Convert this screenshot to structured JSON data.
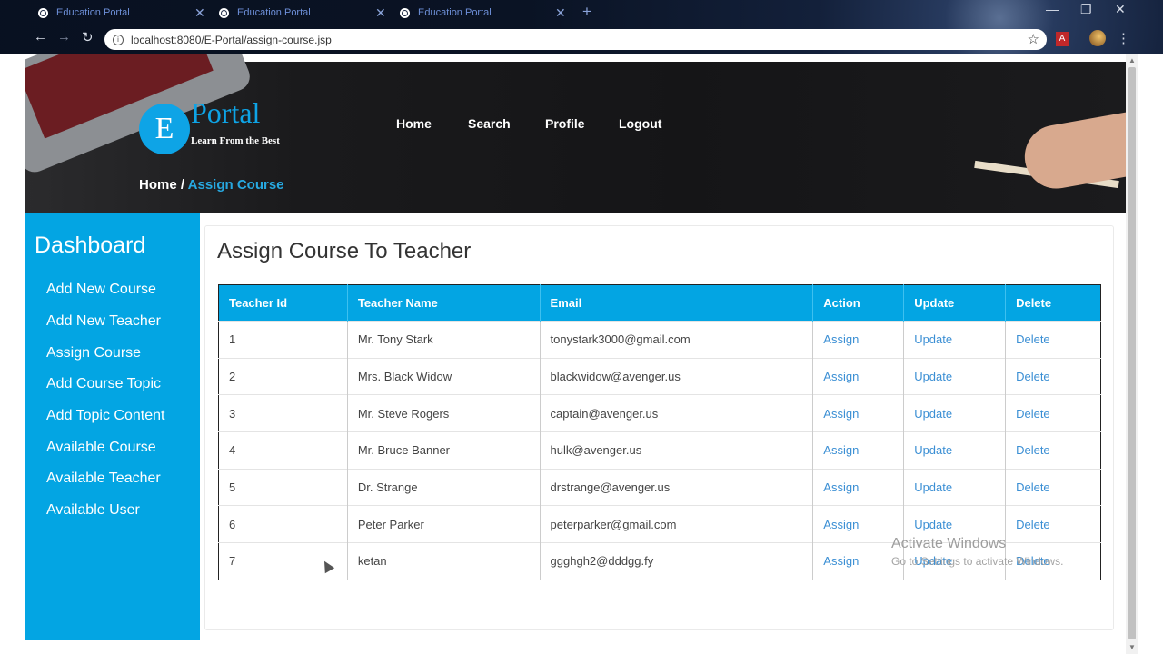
{
  "browser": {
    "tabs": [
      {
        "label": "Education Portal"
      },
      {
        "label": "Education Portal"
      },
      {
        "label": "Education Portal"
      }
    ],
    "url": "localhost:8080/E-Portal/assign-course.jsp",
    "pdf_label": "A"
  },
  "header": {
    "logo_letter": "E",
    "brand": "Portal",
    "tagline": "Learn From the Best",
    "nav": [
      "Home",
      "Search",
      "Profile",
      "Logout"
    ],
    "breadcrumb": {
      "home": "Home /",
      "current": "Assign Course"
    }
  },
  "sidebar": {
    "title": "Dashboard",
    "items": [
      "Add New Course",
      "Add New Teacher",
      "Assign Course",
      "Add Course Topic",
      "Add Topic Content",
      "Available Course",
      "Available Teacher",
      "Available User"
    ]
  },
  "main": {
    "title": "Assign Course To Teacher",
    "columns": [
      "Teacher Id",
      "Teacher Name",
      "Email",
      "Action",
      "Update",
      "Delete"
    ],
    "rows": [
      {
        "id": "1",
        "name": "Mr. Tony Stark",
        "email": "tonystark3000@gmail.com",
        "action": "Assign",
        "update": "Update",
        "delete": "Delete"
      },
      {
        "id": "2",
        "name": "Mrs. Black Widow",
        "email": "blackwidow@avenger.us",
        "action": "Assign",
        "update": "Update",
        "delete": "Delete"
      },
      {
        "id": "3",
        "name": "Mr. Steve Rogers",
        "email": "captain@avenger.us",
        "action": "Assign",
        "update": "Update",
        "delete": "Delete"
      },
      {
        "id": "4",
        "name": "Mr. Bruce Banner",
        "email": "hulk@avenger.us",
        "action": "Assign",
        "update": "Update",
        "delete": "Delete"
      },
      {
        "id": "5",
        "name": "Dr. Strange",
        "email": "drstrange@avenger.us",
        "action": "Assign",
        "update": "Update",
        "delete": "Delete"
      },
      {
        "id": "6",
        "name": "Peter Parker",
        "email": "peterparker@gmail.com",
        "action": "Assign",
        "update": "Update",
        "delete": "Delete"
      },
      {
        "id": "7",
        "name": "ketan",
        "email": "ggghgh2@dddgg.fy",
        "action": "Assign",
        "update": "Update",
        "delete": "Delete"
      }
    ]
  },
  "watermark": {
    "line1": "Activate Windows",
    "line2": "Go to Settings to activate Windows."
  },
  "colors": {
    "accent": "#03a5e3",
    "link": "#3b8fd4"
  }
}
